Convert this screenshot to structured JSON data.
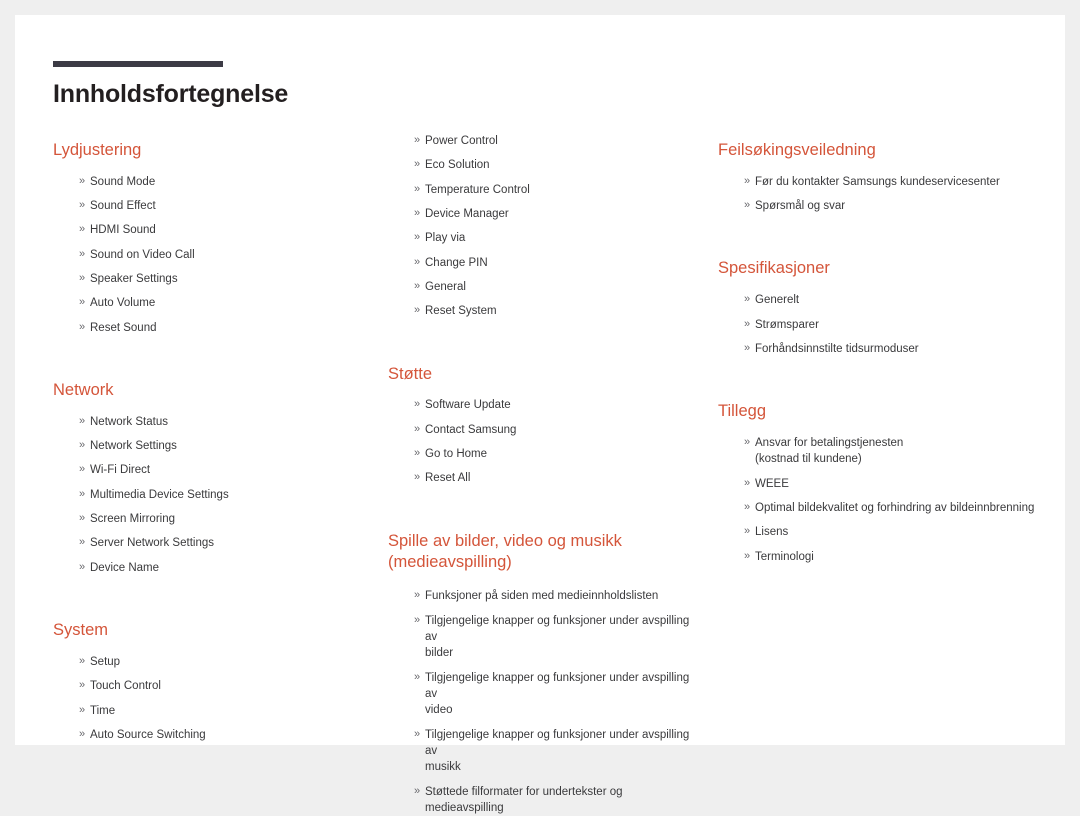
{
  "document": {
    "title": "Innholdsfortegnelse",
    "bullet": "»",
    "accent_color": "#d4553a",
    "rule_color": "#3c3b45",
    "text_color": "#3a3a3c",
    "page_background": "#ffffff",
    "canvas_background": "#efefef"
  },
  "columns": [
    {
      "name": "column-left",
      "sections": [
        {
          "heading": "Lydjustering",
          "items": [
            {
              "text": "Sound Mode"
            },
            {
              "text": "Sound Effect"
            },
            {
              "text": "HDMI Sound"
            },
            {
              "text": "Sound on Video Call"
            },
            {
              "text": "Speaker Settings"
            },
            {
              "text": "Auto Volume"
            },
            {
              "text": "Reset Sound"
            }
          ]
        },
        {
          "heading": "Network",
          "items": [
            {
              "text": "Network Status"
            },
            {
              "text": "Network Settings"
            },
            {
              "text": "Wi-Fi Direct"
            },
            {
              "text": "Multimedia Device Settings"
            },
            {
              "text": "Screen Mirroring"
            },
            {
              "text": "Server Network Settings"
            },
            {
              "text": "Device Name"
            }
          ]
        },
        {
          "heading": "System",
          "items": [
            {
              "text": "Setup"
            },
            {
              "text": "Touch Control"
            },
            {
              "text": "Time"
            },
            {
              "text": "Auto Source Switching"
            }
          ]
        }
      ]
    },
    {
      "name": "column-middle",
      "sections": [
        {
          "heading": "",
          "items": [
            {
              "text": "Power Control"
            },
            {
              "text": "Eco Solution"
            },
            {
              "text": "Temperature Control"
            },
            {
              "text": "Device Manager"
            },
            {
              "text": "Play via"
            },
            {
              "text": "Change PIN"
            },
            {
              "text": "General"
            },
            {
              "text": "Reset System"
            }
          ]
        },
        {
          "heading": "Støtte",
          "items": [
            {
              "text": "Software Update"
            },
            {
              "text": "Contact Samsung"
            },
            {
              "text": "Go to Home"
            },
            {
              "text": "Reset All"
            }
          ]
        },
        {
          "heading": "Spille av bilder, video og musikk (medieavspilling)",
          "items": [
            {
              "text": "Funksjoner på siden med medieinnholdslisten"
            },
            {
              "text": "Tilgjengelige knapper og funksjoner under avspilling av",
              "cont": "bilder"
            },
            {
              "text": "Tilgjengelige knapper og funksjoner under avspilling av",
              "cont": "video"
            },
            {
              "text": "Tilgjengelige knapper og funksjoner under avspilling av",
              "cont": "musikk"
            },
            {
              "text": "Støttede filformater for undertekster og medieavspilling"
            }
          ]
        }
      ]
    },
    {
      "name": "column-right",
      "sections": [
        {
          "heading": "Feilsøkingsveiledning",
          "items": [
            {
              "text": "Før du kontakter Samsungs kundeservicesenter"
            },
            {
              "text": "Spørsmål og svar"
            }
          ]
        },
        {
          "heading": "Spesifikasjoner",
          "items": [
            {
              "text": "Generelt"
            },
            {
              "text": "Strømsparer"
            },
            {
              "text": "Forhåndsinnstilte tidsurmoduser"
            }
          ]
        },
        {
          "heading": "Tillegg",
          "items": [
            {
              "text": "Ansvar for betalingstjenesten",
              "cont": "(kostnad til kundene)"
            },
            {
              "text": "WEEE"
            },
            {
              "text": "Optimal bildekvalitet og forhindring av bildeinnbrenning"
            },
            {
              "text": "Lisens"
            },
            {
              "text": "Terminologi"
            }
          ]
        }
      ]
    }
  ]
}
